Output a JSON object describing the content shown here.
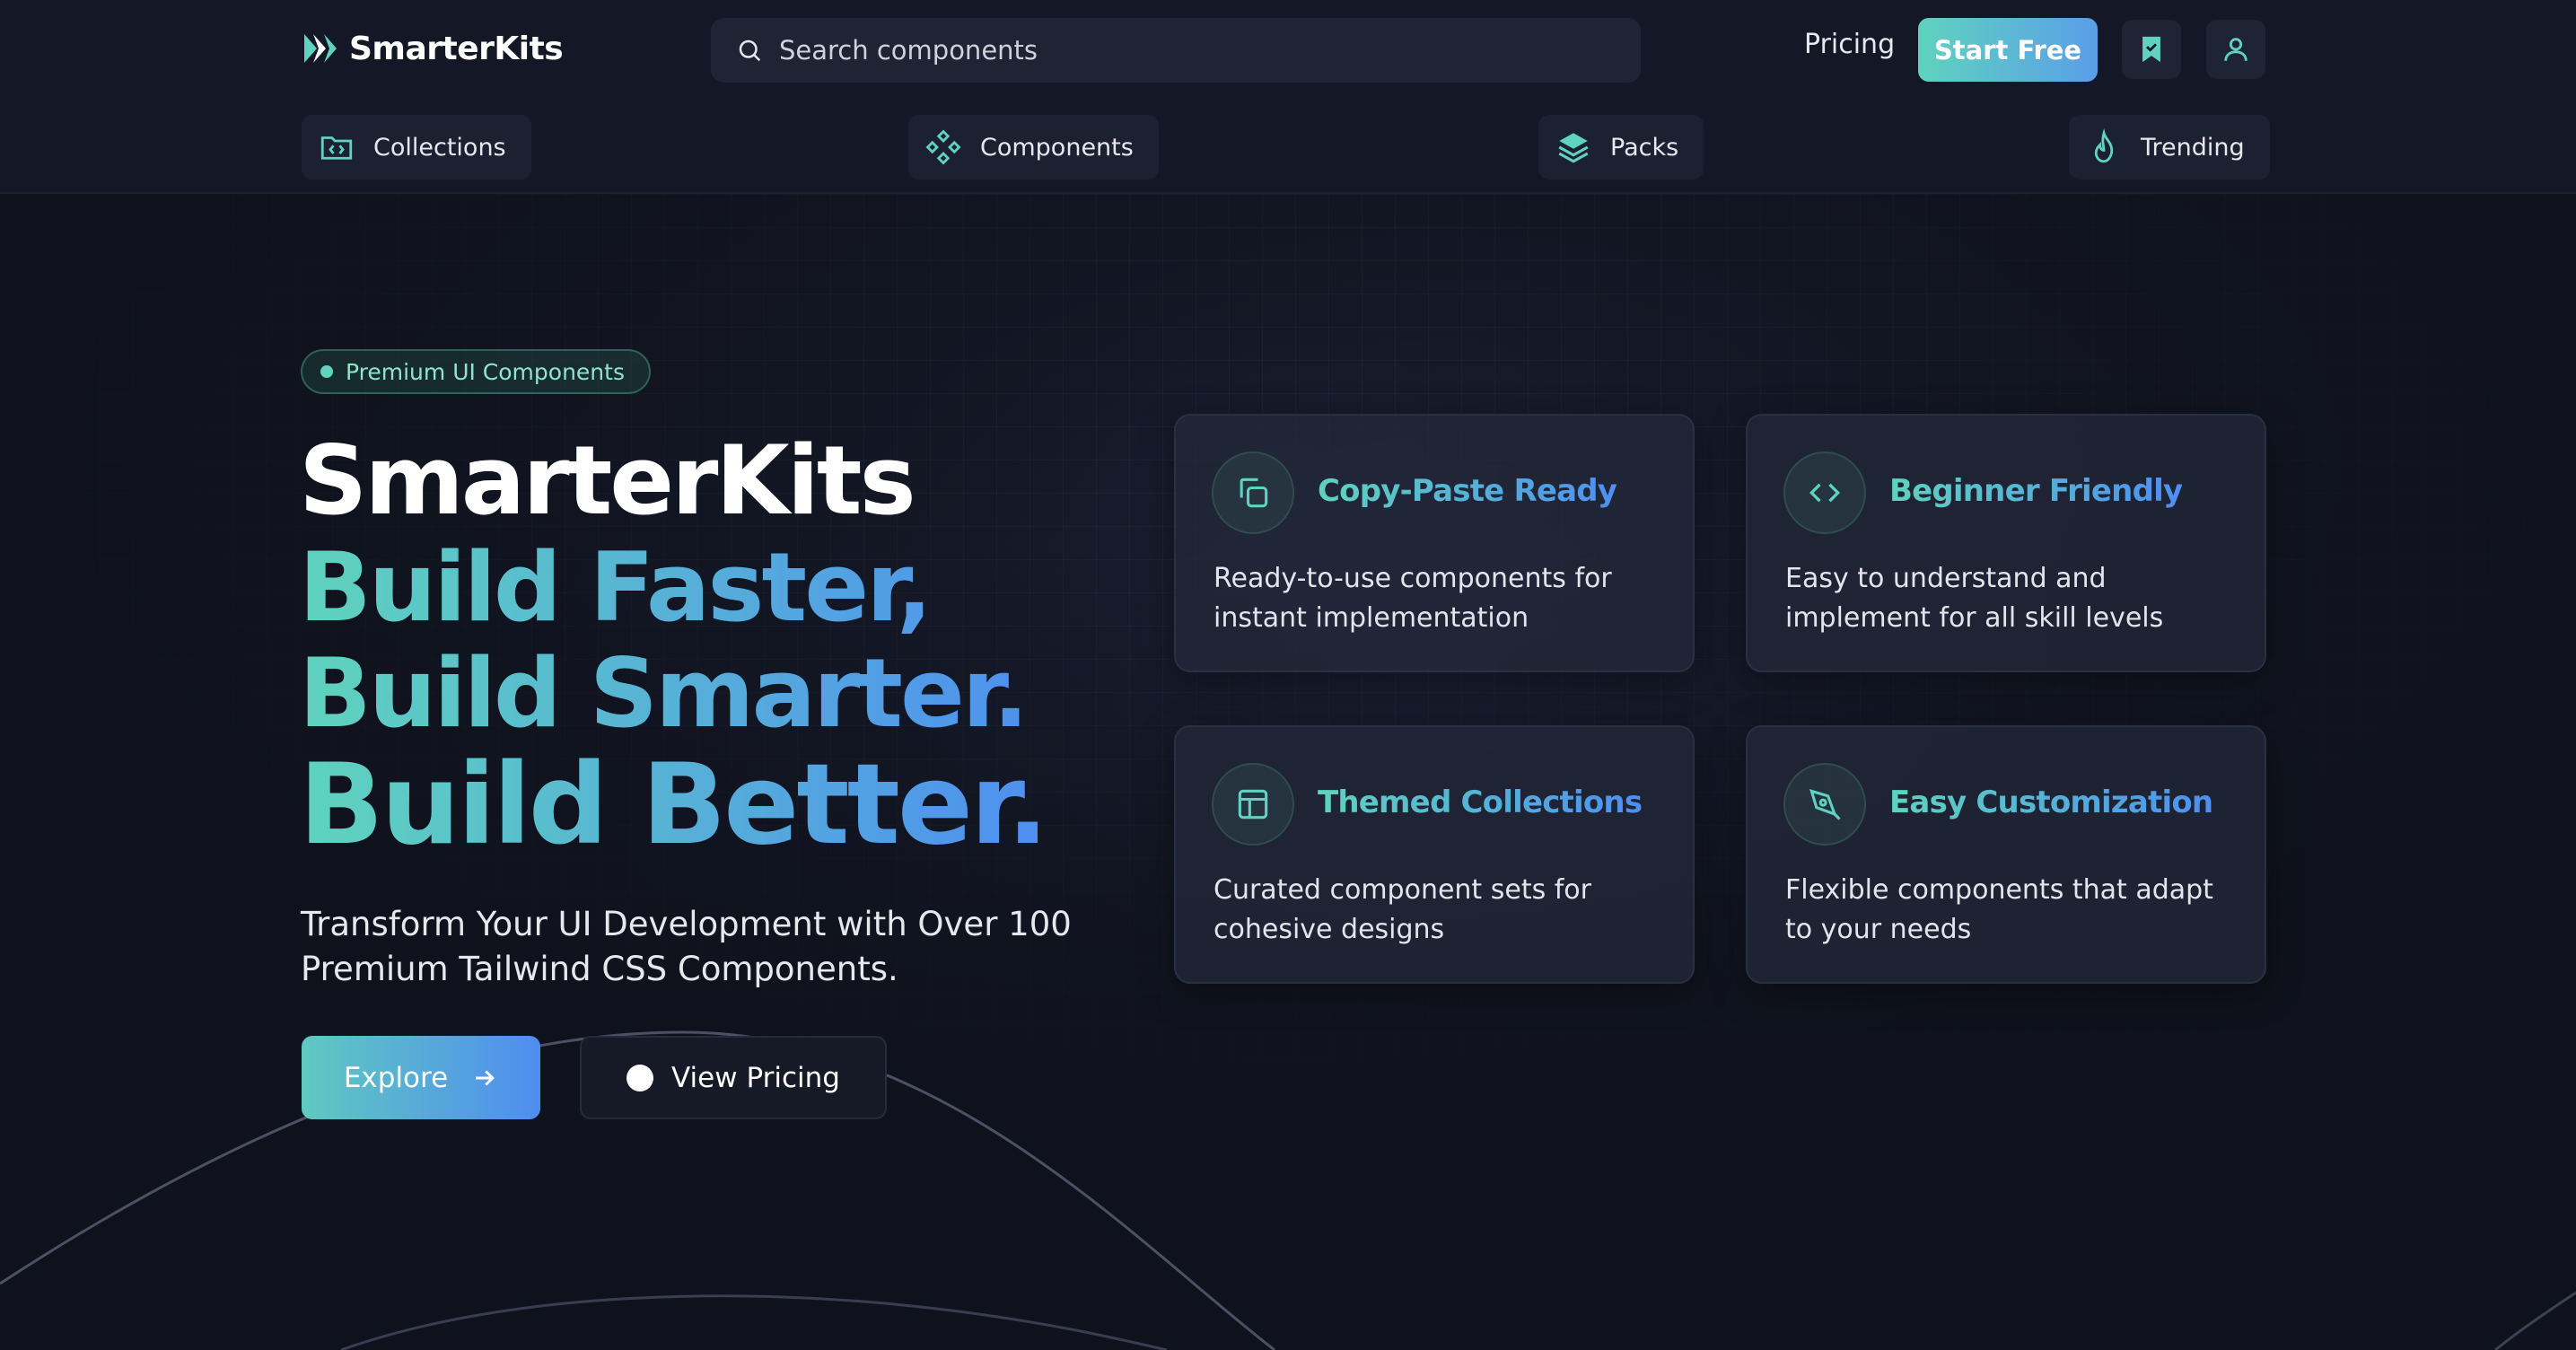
{
  "brand": {
    "name": "SmarterKits"
  },
  "search": {
    "placeholder": "Search components"
  },
  "header": {
    "pricing_label": "Pricing",
    "start_free_label": "Start Free"
  },
  "nav": [
    {
      "label": "Collections",
      "icon": "folder-code-icon"
    },
    {
      "label": "Components",
      "icon": "components-icon"
    },
    {
      "label": "Packs",
      "icon": "layers-icon"
    },
    {
      "label": "Trending",
      "icon": "flame-icon"
    }
  ],
  "hero": {
    "badge": "Premium UI Components",
    "title": "SmarterKits",
    "tagline_1": "Build Faster,",
    "tagline_2": "Build Smarter.",
    "tagline_3": "Build Better.",
    "subtitle": "Transform Your UI Development with Over 100 Premium Tailwind CSS Components.",
    "explore_label": "Explore",
    "view_pricing_label": "View Pricing"
  },
  "features": [
    {
      "title": "Copy-Paste Ready",
      "description": "Ready-to-use components for instant implementation",
      "icon": "copy-icon"
    },
    {
      "title": "Beginner Friendly",
      "description": "Easy to understand and implement for all skill levels",
      "icon": "code-icon"
    },
    {
      "title": "Themed Collections",
      "description": "Curated component sets for cohesive designs",
      "icon": "layout-icon"
    },
    {
      "title": "Easy Customization",
      "description": "Flexible components that adapt to your needs",
      "icon": "pen-tool-icon"
    }
  ],
  "colors": {
    "accent_teal": "#5fd3be",
    "accent_blue": "#4e8ff0",
    "background": "#141826"
  }
}
